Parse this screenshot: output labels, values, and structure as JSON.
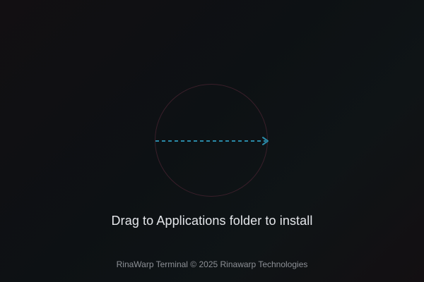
{
  "installer": {
    "instruction": "Drag to Applications folder to install",
    "footer": "RinaWarp Terminal © 2025 Rinawarp Technologies"
  },
  "colors": {
    "arrow": "#2a8aa8",
    "circle": "#3a1f2a",
    "text": "#e4e6ea",
    "footer_text": "#8d9096"
  },
  "icons": {
    "drag_arrow": "dashed-arrow-right-icon",
    "drop_target": "circle-outline"
  }
}
